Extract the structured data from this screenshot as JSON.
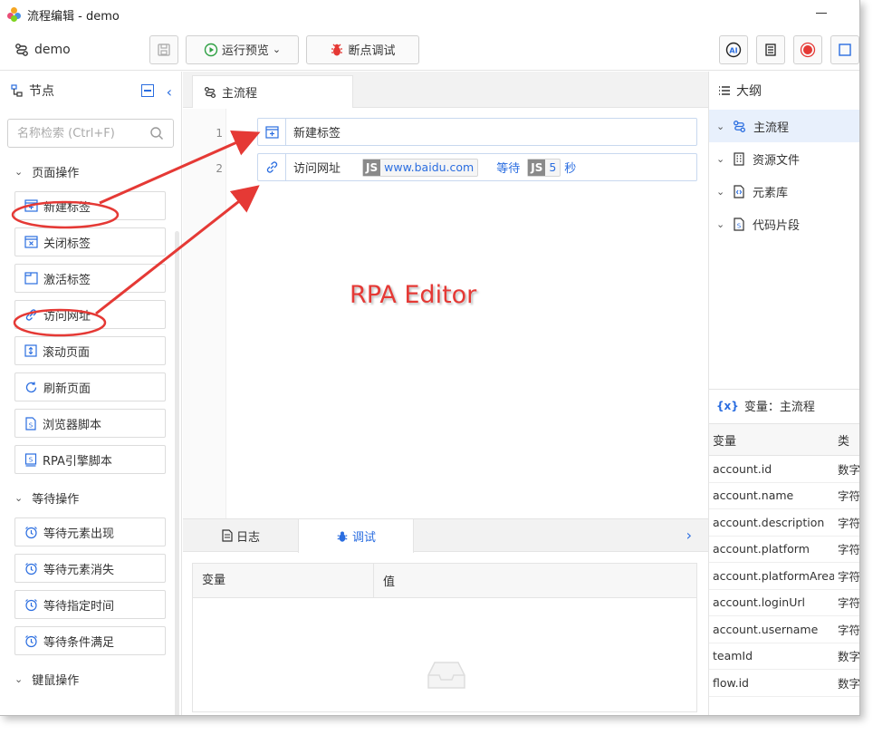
{
  "window": {
    "title": "流程编辑 - demo"
  },
  "toolbar": {
    "project_name": "demo",
    "run_preview_label": "运行预览",
    "debug_label": "断点调试"
  },
  "left_panel": {
    "title": "节点",
    "search_placeholder": "名称检索 (Ctrl+F)",
    "groups": [
      {
        "title": "页面操作",
        "items": [
          "新建标签",
          "关闭标签",
          "激活标签",
          "访问网址",
          "滚动页面",
          "刷新页面",
          "浏览器脚本",
          "RPA引擎脚本"
        ]
      },
      {
        "title": "等待操作",
        "items": [
          "等待元素出现",
          "等待元素消失",
          "等待指定时间",
          "等待条件满足"
        ]
      },
      {
        "title": "键鼠操作",
        "items": []
      }
    ]
  },
  "center": {
    "tab_label": "主流程",
    "steps": [
      {
        "line": "1",
        "label": "新建标签"
      },
      {
        "line": "2",
        "label": "访问网址",
        "url_tag": "JS",
        "url": "www.baidu.com",
        "wait_label": "等待",
        "wait_tag": "JS",
        "wait_value": "5",
        "wait_unit": "秒"
      }
    ],
    "annotation": "RPA Editor",
    "bottom_tabs": [
      "日志",
      "调试"
    ],
    "table_headers": [
      "变量",
      "值"
    ]
  },
  "right_panel": {
    "title": "大纲",
    "tree": [
      "主流程",
      "资源文件",
      "元素库",
      "代码片段"
    ],
    "variables_title": "变量：主流程",
    "var_headers": [
      "变量",
      "类"
    ],
    "variables": [
      {
        "name": "account.id",
        "type": "数字"
      },
      {
        "name": "account.name",
        "type": "字符"
      },
      {
        "name": "account.description",
        "type": "字符"
      },
      {
        "name": "account.platform",
        "type": "字符"
      },
      {
        "name": "account.platformArea",
        "type": "字符"
      },
      {
        "name": "account.loginUrl",
        "type": "字符"
      },
      {
        "name": "account.username",
        "type": "字符"
      },
      {
        "name": "teamId",
        "type": "数字"
      },
      {
        "name": "flow.id",
        "type": "数字"
      }
    ]
  },
  "colors": {
    "accent": "#2a6de0",
    "annotation": "#e53935"
  }
}
